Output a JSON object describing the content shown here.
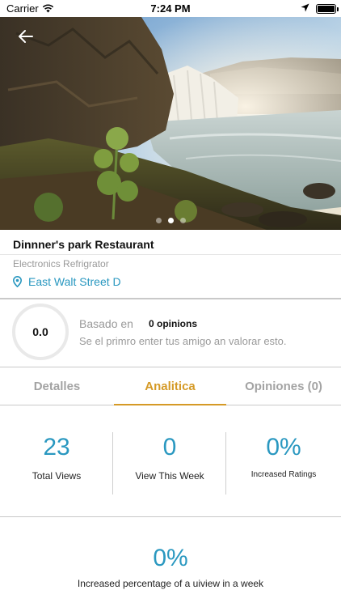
{
  "status_bar": {
    "carrier": "Carrier",
    "time": "7:24 PM"
  },
  "hero": {
    "image_alt": "Waterfall landscape",
    "slide_count": 3,
    "active_slide": 2
  },
  "place": {
    "title": "Dinnner's park Restaurant",
    "category": "Electronics Refrigrator",
    "address": "East Walt Street D"
  },
  "rating": {
    "score": "0.0",
    "based_on": "Basado en",
    "opinions": "0 opinions",
    "invite": "Se el primro enter tus amigo an valorar esto."
  },
  "tabs": [
    {
      "label": "Detalles",
      "active": false
    },
    {
      "label": "Analitica",
      "active": true
    },
    {
      "label": "Opiniones (0)",
      "active": false
    }
  ],
  "stats": [
    {
      "value": "23",
      "label": "Total Views"
    },
    {
      "value": "0",
      "label": "View This Week"
    },
    {
      "value": "0%",
      "label": "Increased Ratings"
    }
  ],
  "weekly": {
    "value": "0%",
    "label": "Increased percentage of a uiview in a week"
  },
  "colors": {
    "accent_blue": "#2a98c0",
    "accent_gold": "#d59a26",
    "muted_text": "#9a9a9a"
  }
}
